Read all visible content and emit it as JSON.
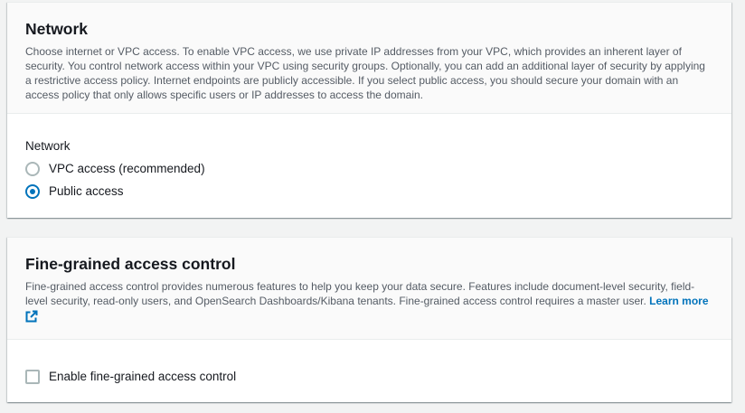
{
  "network": {
    "title": "Network",
    "description": "Choose internet or VPC access. To enable VPC access, we use private IP addresses from your VPC, which provides an inherent layer of security. You control network access within your VPC using security groups. Optionally, you can add an additional layer of security by applying a restrictive access policy. Internet endpoints are publicly accessible. If you select public access, you should secure your domain with an access policy that only allows specific users or IP addresses to access the domain.",
    "field_label": "Network",
    "options": [
      {
        "label": "VPC access (recommended)",
        "selected": false
      },
      {
        "label": "Public access",
        "selected": true
      }
    ]
  },
  "fine_grained": {
    "title": "Fine-grained access control",
    "description": "Fine-grained access control provides numerous features to help you keep your data secure. Features include document-level security, field-level security, read-only users, and OpenSearch Dashboards/Kibana tenants. Fine-grained access control requires a master user.",
    "learn_more": "Learn more",
    "external_link_icon": "external-link-icon",
    "checkbox_label": "Enable fine-grained access control",
    "checkbox_checked": false
  },
  "colors": {
    "accent": "#0073bb",
    "text": "#16191f",
    "secondary_text": "#545b64",
    "background": "#f2f3f3",
    "header_bg": "#fafafa"
  }
}
